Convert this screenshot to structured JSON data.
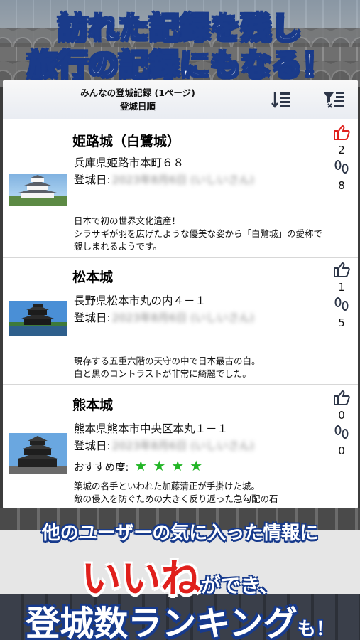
{
  "promo": {
    "headline_line1": "訪れた記録を残し",
    "headline_line2": "旅行の記録にもなる！",
    "bottom_line1": "他のユーザーの気に入った情報に",
    "bottom_iine": "いいね",
    "bottom_dekiru": "ができ、",
    "bottom_ranking": "登城数ランキング",
    "bottom_mo": "も！"
  },
  "nav": {
    "title_line1": "みんなの登城記録 (1ページ)",
    "title_line2": "登城日順",
    "sort_icon": "list-sort-icon",
    "filter_icon": "filter-icon"
  },
  "records": [
    {
      "name": "姫路城（白鷺城）",
      "address": "兵庫県姫路市本町６８",
      "visit_label": "登城日:",
      "visit_value": "2023年8月6日 (いしいさん)",
      "description": "日本で初の世界文化遺産！\nシラサギが羽を広げたような優美な姿から「白鷺城」の愛称で親しまれるようです。",
      "likes": "2",
      "visits": "8",
      "liked": true,
      "like_color": "#e0201c"
    },
    {
      "name": "松本城",
      "address": "長野県松本市丸の内４－１",
      "visit_label": "登城日:",
      "visit_value": "2023年8月6日 (いしいさん)",
      "description": "現存する五重六階の天守の中で日本最古の白。\n白と黒のコントラストが非常に綺麗でした。",
      "likes": "1",
      "visits": "5",
      "liked": false,
      "like_color": "#2d3648"
    },
    {
      "name": "熊本城",
      "address": "熊本県熊本市中央区本丸１－１",
      "visit_label": "登城日:",
      "visit_value": "2023年8月6日 (いしいさん)",
      "recommend_label": "おすすめ度:",
      "stars": 4,
      "star_color": "#22b526",
      "description": "築城の名手といわれた加藤清正が手掛けた城。\n敵の侵入を防ぐための大きく反り返った急勾配の石",
      "likes": "0",
      "visits": "0",
      "liked": false,
      "like_color": "#2d3648"
    }
  ]
}
